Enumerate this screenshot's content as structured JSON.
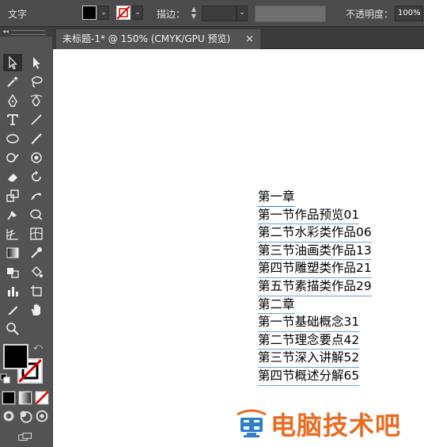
{
  "control_bar": {
    "type_label": "文字",
    "stroke_label": "描边：",
    "opacity_label": "不透明度：",
    "opacity_value": "100%"
  },
  "toolbar": {
    "collapse_glyph": "◂◂"
  },
  "tabs": [
    {
      "label": "未标题-1* @ 150% (CMYK/GPU 预览)",
      "close": "×"
    }
  ],
  "artboard": {
    "lines": [
      "第一章",
      "第一节作品预览01",
      "第二节水彩类作品06",
      "第三节油画类作品13",
      "第四节雕塑类作品21",
      "第五节素描类作品29",
      "第二章",
      "第一节基础概念31",
      "第二节理念要点42",
      "第三节深入讲解52",
      "第四节概述分解65"
    ]
  },
  "watermark": {
    "text": "电脑技术吧"
  },
  "colors": {
    "accent_blue": "#2f80c9",
    "watermark_orange": "#ea6b21",
    "selection_underline": "#6fa3d6"
  }
}
